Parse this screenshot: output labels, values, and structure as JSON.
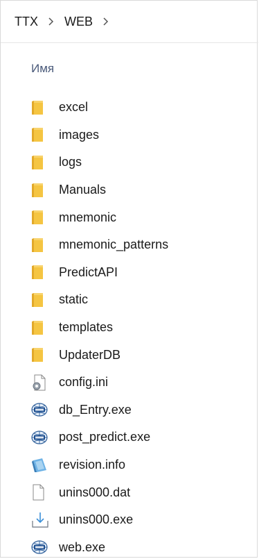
{
  "breadcrumb": {
    "items": [
      "TTX",
      "WEB"
    ]
  },
  "header": {
    "name_column": "Имя"
  },
  "files": [
    {
      "name": "excel",
      "icon": "folder-icon"
    },
    {
      "name": "images",
      "icon": "folder-icon"
    },
    {
      "name": "logs",
      "icon": "folder-icon"
    },
    {
      "name": "Manuals",
      "icon": "folder-icon"
    },
    {
      "name": "mnemonic",
      "icon": "folder-icon"
    },
    {
      "name": "mnemonic_patterns",
      "icon": "folder-icon"
    },
    {
      "name": "PredictAPI",
      "icon": "folder-icon"
    },
    {
      "name": "static",
      "icon": "folder-icon"
    },
    {
      "name": "templates",
      "icon": "folder-icon"
    },
    {
      "name": "UpdaterDB",
      "icon": "folder-icon"
    },
    {
      "name": "config.ini",
      "icon": "settings-file-icon"
    },
    {
      "name": "db_Entry.exe",
      "icon": "executable-icon"
    },
    {
      "name": "post_predict.exe",
      "icon": "executable-icon"
    },
    {
      "name": "revision.info",
      "icon": "info-file-icon"
    },
    {
      "name": "unins000.dat",
      "icon": "blank-file-icon"
    },
    {
      "name": "unins000.exe",
      "icon": "installer-icon"
    },
    {
      "name": "web.exe",
      "icon": "executable-icon"
    }
  ],
  "colors": {
    "folder": "#f5c542",
    "folder_dark": "#e2a92a",
    "text": "#1a1a1a",
    "header_text": "#4a5a7a"
  }
}
